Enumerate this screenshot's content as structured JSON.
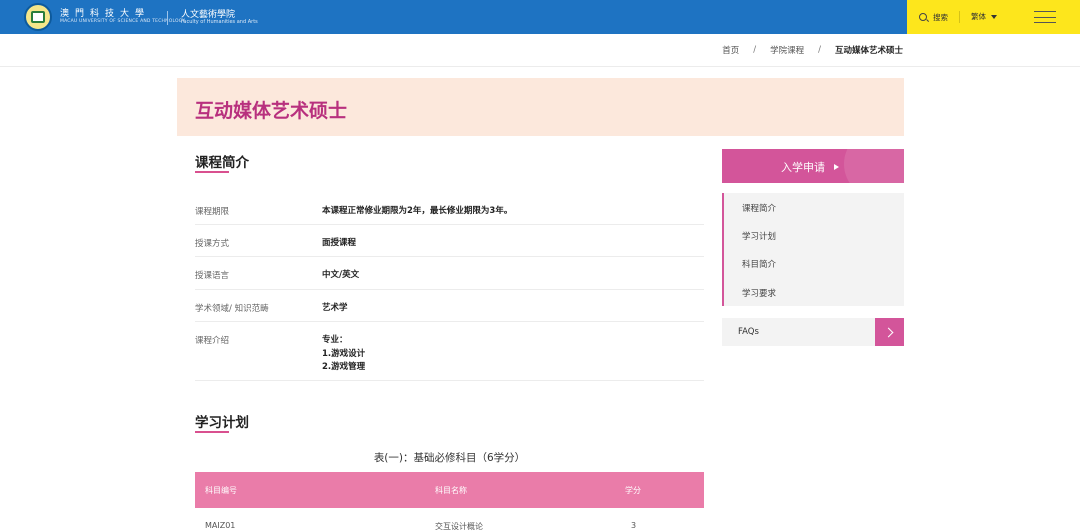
{
  "header": {
    "logo_cn": "澳門科技大學",
    "logo_en": "MACAU UNIVERSITY OF SCIENCE AND TECHNOLOGY",
    "faculty_cn": "人文藝術學院",
    "faculty_en": "Faculty of Humanities and Arts",
    "search_label": "搜索",
    "lang_label": "繁体",
    "colors": {
      "primary": "#1e73c2",
      "utility_bar": "#fde61c"
    }
  },
  "breadcrumb": {
    "items": [
      "首页",
      "学院课程",
      "互动媒体艺术硕士"
    ],
    "separator": "/"
  },
  "banner": {
    "title": "互动媒体艺术硕士",
    "color": "#b8307e",
    "bg": "#fce8dc"
  },
  "intro": {
    "title": "课程简介",
    "rows": [
      {
        "key": "课程期限",
        "value": "本课程正常修业期限为2年，最长修业期限为3年。"
      },
      {
        "key": "授课方式",
        "value": "面授课程"
      },
      {
        "key": "授课语言",
        "value": "中文/英文"
      },
      {
        "key": "学术领域/ 知识范畴",
        "value": "艺术学"
      },
      {
        "key": "课程介绍",
        "value_lines": [
          "专业：",
          "1.游戏设计",
          "2.游戏管理"
        ]
      }
    ]
  },
  "sidebar": {
    "apply_label": "入学申请",
    "nav": [
      "课程简介",
      "学习计划",
      "科目简介",
      "学习要求"
    ],
    "faq_label": "FAQs",
    "accent": "#d3559a"
  },
  "plan": {
    "title": "学习计划",
    "table_caption": "表(一)：基础必修科目（6学分）",
    "columns": [
      "科目编号",
      "科目名称",
      "学分"
    ],
    "rows": [
      {
        "code": "MAIZ01",
        "name": "交互设计概论",
        "credit": "3"
      }
    ],
    "header_color": "#ea7ca9"
  }
}
